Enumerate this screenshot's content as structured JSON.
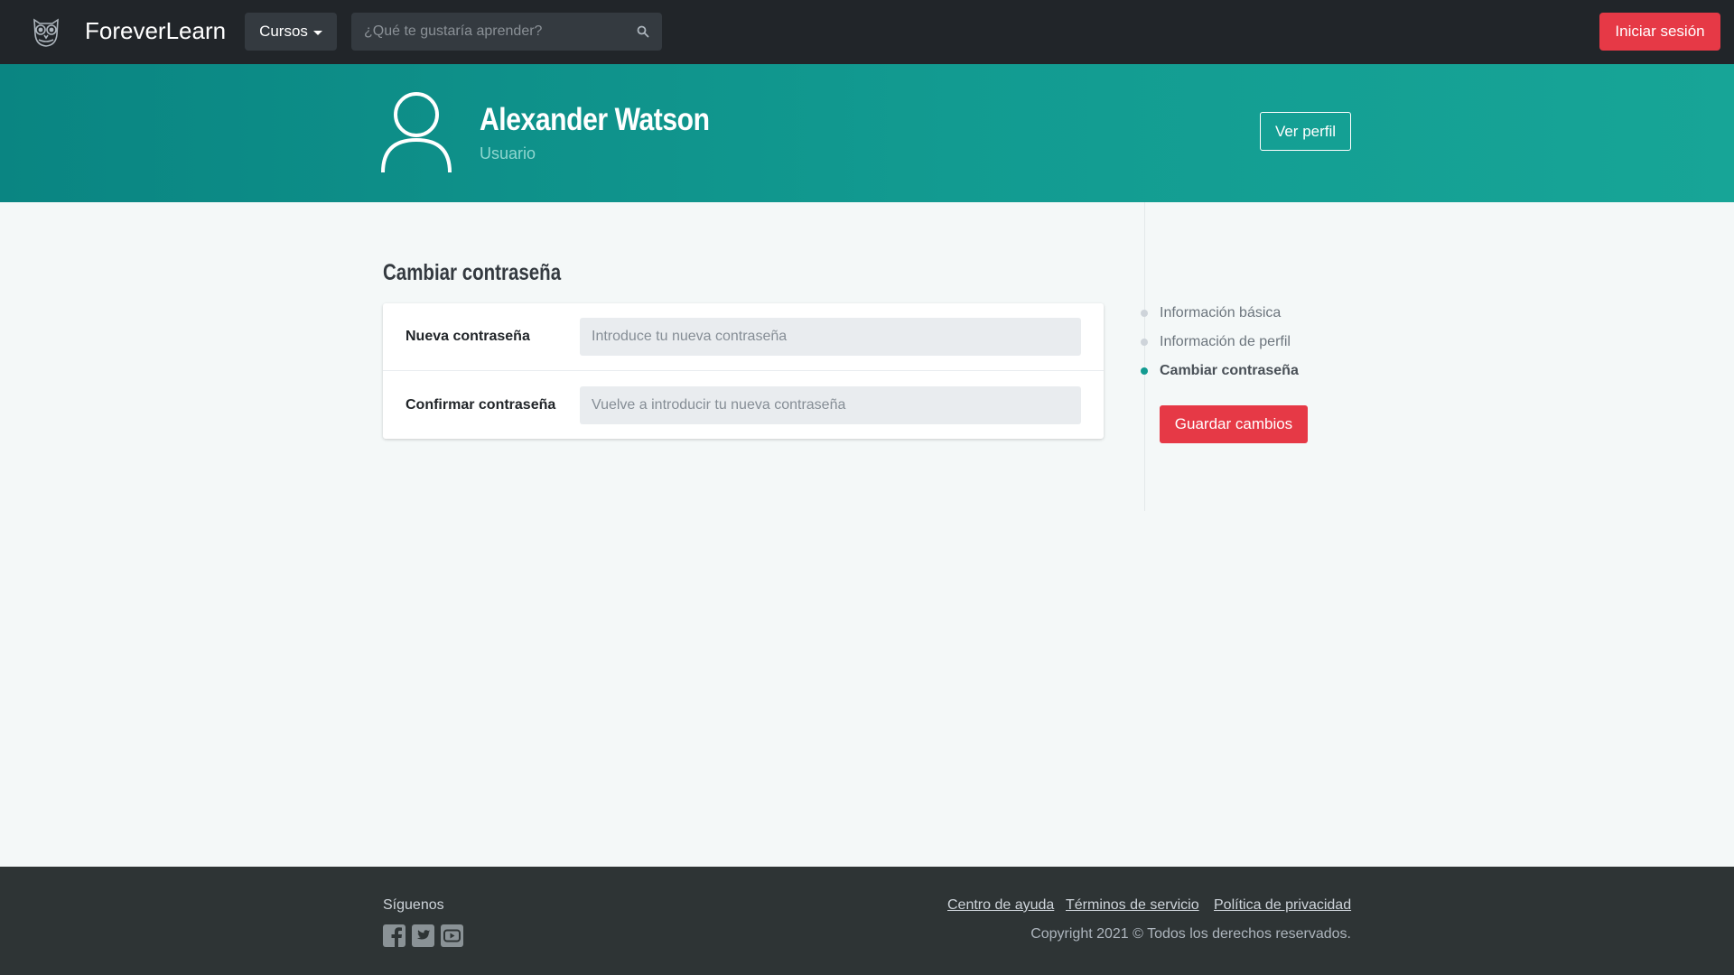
{
  "navbar": {
    "brand": "ForeverLearn",
    "logo_icon": "owl-logo-icon",
    "courses_label": "Cursos",
    "search_placeholder": "¿Qué te gustaría aprender?",
    "login_label": "Iniciar sesión"
  },
  "hero": {
    "user_name": "Alexander Watson",
    "user_role": "Usuario",
    "view_profile_label": "Ver perfil",
    "avatar_icon": "user-avatar-icon"
  },
  "main": {
    "section_title": "Cambiar contraseña",
    "form": {
      "new_password_label": "Nueva contraseña",
      "new_password_placeholder": "Introduce tu nueva contraseña",
      "confirm_password_label": "Confirmar contraseña",
      "confirm_password_placeholder": "Vuelve a introducir tu nueva contraseña"
    }
  },
  "sidebar": {
    "items": [
      {
        "label": "Información básica",
        "active": false
      },
      {
        "label": "Información de perfil",
        "active": false
      },
      {
        "label": "Cambiar contraseña",
        "active": true
      }
    ],
    "save_label": "Guardar cambios"
  },
  "footer": {
    "follow_label": "Síguenos",
    "social_icons": [
      "facebook-icon",
      "twitter-icon",
      "youtube-icon"
    ],
    "links": [
      "Centro de ayuda",
      "Términos de servicio",
      "Política de privacidad"
    ],
    "copyright": "Copyright 2021 © Todos los derechos reservados."
  },
  "colors": {
    "navbar_bg": "#212529",
    "accent_red": "#e63946",
    "teal": "#129b91",
    "footer_bg": "#2e3435"
  }
}
